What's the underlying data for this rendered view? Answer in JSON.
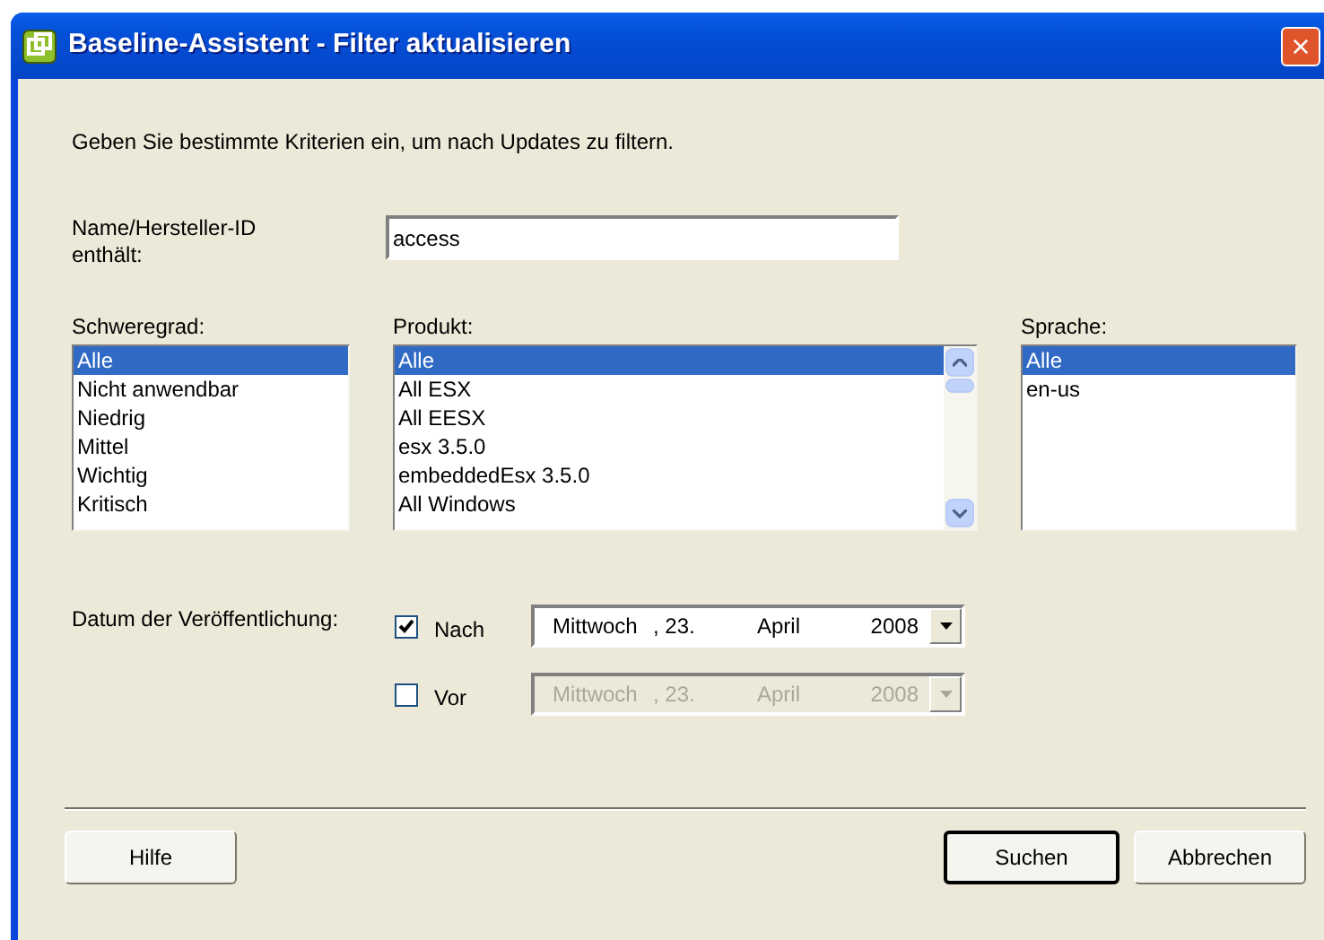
{
  "window": {
    "title": "Baseline-Assistent - Filter aktualisieren",
    "close": "×"
  },
  "intro": "Geben Sie bestimmte Kriterien ein, um nach Updates zu filtern.",
  "name_filter": {
    "label": "Name/Hersteller-ID enthält:",
    "value": "access"
  },
  "lists": [
    {
      "label": "Schweregrad:",
      "scrollbar": false,
      "items": [
        {
          "text": "Alle",
          "selected": true
        },
        {
          "text": "Nicht anwendbar",
          "selected": false
        },
        {
          "text": "Niedrig",
          "selected": false
        },
        {
          "text": "Mittel",
          "selected": false
        },
        {
          "text": "Wichtig",
          "selected": false
        },
        {
          "text": "Kritisch",
          "selected": false
        }
      ]
    },
    {
      "label": "Produkt:",
      "scrollbar": true,
      "items": [
        {
          "text": "Alle",
          "selected": true
        },
        {
          "text": "All ESX",
          "selected": false
        },
        {
          "text": "All EESX",
          "selected": false
        },
        {
          "text": "esx 3.5.0",
          "selected": false
        },
        {
          "text": "embeddedEsx 3.5.0",
          "selected": false
        },
        {
          "text": "All Windows",
          "selected": false
        }
      ]
    },
    {
      "label": "Sprache:",
      "scrollbar": false,
      "items": [
        {
          "text": "Alle",
          "selected": true
        },
        {
          "text": "en-us",
          "selected": false
        }
      ]
    }
  ],
  "release_date": {
    "label": "Datum der Veröffentlichung:",
    "rows": [
      {
        "label": "Nach",
        "checked": true,
        "date": [
          "Mittwoch",
          ", 23.",
          "April",
          "2008"
        ]
      },
      {
        "label": "Vor",
        "checked": false,
        "date": [
          "Mittwoch",
          ", 23.",
          "April",
          "2008"
        ]
      }
    ]
  },
  "buttons": [
    {
      "label": "Hilfe",
      "default": false
    },
    {
      "label": "Suchen",
      "default": true
    },
    {
      "label": "Abbrechen",
      "default": false
    }
  ]
}
